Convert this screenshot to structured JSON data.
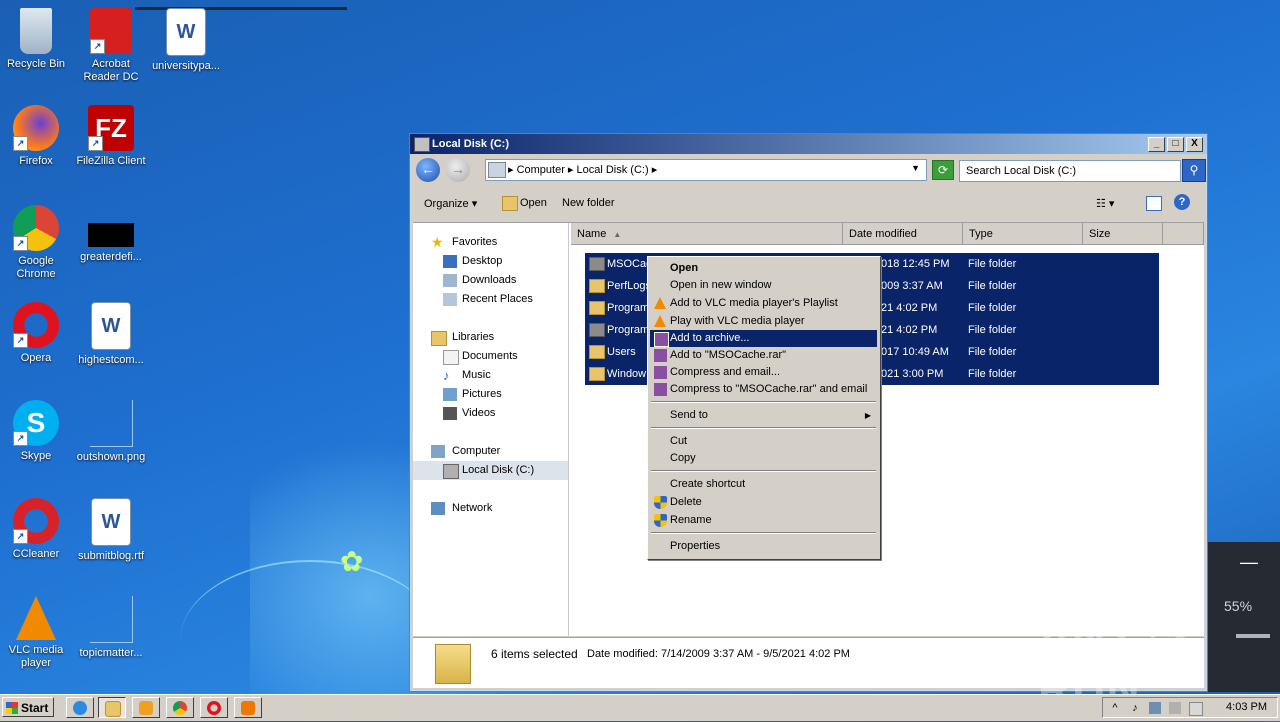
{
  "desktop": {
    "icons": [
      {
        "label": "Recycle Bin"
      },
      {
        "label": "Acrobat Reader DC"
      },
      {
        "label": "universitypa..."
      },
      {
        "label": "Firefox"
      },
      {
        "label": "FileZilla Client"
      },
      {
        "label": "Google Chrome"
      },
      {
        "label": "greaterdefi..."
      },
      {
        "label": "Opera"
      },
      {
        "label": "highestcom..."
      },
      {
        "label": "Skype"
      },
      {
        "label": "outshown.png"
      },
      {
        "label": "CCleaner"
      },
      {
        "label": "submitblog.rtf"
      },
      {
        "label": "VLC media player"
      },
      {
        "label": "topicmatter..."
      }
    ]
  },
  "window": {
    "title": "Local Disk (C:)",
    "controls": {
      "minimize": "_",
      "maximize": "□",
      "close": "X"
    },
    "address": {
      "crumbs": "▸ Computer ▸ Local Disk (C:) ▸"
    },
    "search": {
      "placeholder": "Search Local Disk (C:)"
    },
    "toolbar": {
      "organize": "Organize ▾",
      "open": "Open",
      "new_folder": "New folder"
    },
    "nav": {
      "favorites": "Favorites",
      "desktop": "Desktop",
      "downloads": "Downloads",
      "recent": "Recent Places",
      "libraries": "Libraries",
      "documents": "Documents",
      "music": "Music",
      "pictures": "Pictures",
      "videos": "Videos",
      "computer": "Computer",
      "local_disk": "Local Disk (C:)",
      "network": "Network"
    },
    "columns": {
      "name": "Name",
      "date": "Date modified",
      "type": "Type",
      "size": "Size"
    },
    "files": [
      {
        "name": "MSOCac",
        "date": "018 12:45 PM",
        "type": "File folder"
      },
      {
        "name": "PerfLogs",
        "date": "009 3:37 AM",
        "type": "File folder"
      },
      {
        "name": "Program",
        "date": "21 4:02 PM",
        "type": "File folder"
      },
      {
        "name": "Program",
        "date": "21 4:02 PM",
        "type": "File folder"
      },
      {
        "name": "Users",
        "date": "017 10:49 AM",
        "type": "File folder"
      },
      {
        "name": "Window",
        "date": "021 3:00 PM",
        "type": "File folder"
      }
    ],
    "status": {
      "count": "6 items selected",
      "date_range": "Date modified: 7/14/2009 3:37 AM - 9/5/2021 4:02 PM"
    }
  },
  "context_menu": {
    "items": [
      {
        "label": "Open"
      },
      {
        "label": "Open in new window"
      },
      {
        "label": "Add to VLC media player's Playlist"
      },
      {
        "label": "Play with VLC media player"
      },
      {
        "label": "Add to archive..."
      },
      {
        "label": "Add to \"MSOCache.rar\""
      },
      {
        "label": "Compress and email..."
      },
      {
        "label": "Compress to \"MSOCache.rar\" and email"
      },
      {
        "label": "Send to"
      },
      {
        "label": "Cut"
      },
      {
        "label": "Copy"
      },
      {
        "label": "Create shortcut"
      },
      {
        "label": "Delete"
      },
      {
        "label": "Rename"
      },
      {
        "label": "Properties"
      }
    ]
  },
  "taskbar": {
    "start": "Start",
    "clock": "4:03 PM"
  },
  "side_panel": {
    "minus": "—",
    "zoom": "55%"
  },
  "watermark": "ANY ▷ RUN"
}
